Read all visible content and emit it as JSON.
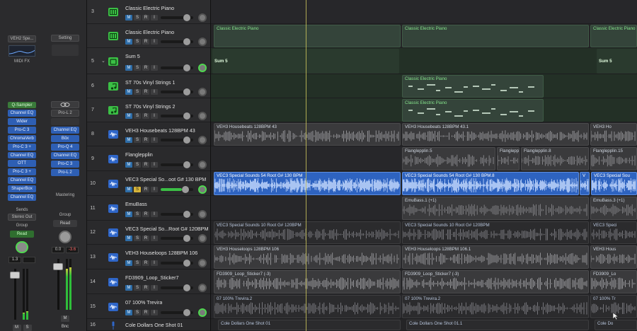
{
  "mixer": {
    "strip_a": {
      "instrument": "VEH2 Spe...",
      "midi_fx": "MIDI FX",
      "instrument_plugin": "Q-Sampler",
      "plugins": [
        "Channel EQ",
        "Wider",
        "Pro-C 3",
        "ChromaVerb",
        "Pro-C 3 +",
        "Channel EQ",
        "OTT",
        "Pro-C 3 +",
        "Channel EQ",
        "ShaperBox",
        "Channel EQ"
      ],
      "sends_label": "Sends",
      "output": "Stereo Out",
      "group_label": "Group",
      "automation": "Read",
      "volume": "1.3",
      "mute": "M",
      "solo": "S"
    },
    "strip_b": {
      "setting": "Setting",
      "link_icon": "link-icon",
      "plugins_top": [
        "Pro-L 2"
      ],
      "plugins": [
        "Channel EQ",
        "Böx",
        "Pro-Q 4",
        "Channel EQ",
        "Pro-C 3",
        "Pro-L 2"
      ],
      "mastering_label": "Mastering",
      "group_label": "Group",
      "automation": "Read",
      "volume": "0.0",
      "peak": "-3.6",
      "mute": "M",
      "bounce": "Bnc"
    }
  },
  "track_buttons": {
    "mute": "M",
    "solo": "S",
    "record": "R",
    "input": "I"
  },
  "tracks": [
    {
      "num": "3",
      "name": "Classic Electric Piano",
      "icon": "keyboard-icon",
      "kind": "midi"
    },
    {
      "num": "",
      "name": "Classic Electric Piano",
      "icon": "keyboard-icon",
      "kind": "midi"
    },
    {
      "num": "5",
      "name": "Sum 5",
      "icon": "stack-icon",
      "kind": "sum"
    },
    {
      "num": "6",
      "name": "ST 70s Vinyl Strings 1",
      "icon": "music-note-icon",
      "kind": "midi"
    },
    {
      "num": "7",
      "name": "ST 70s Vinyl Strings 2",
      "icon": "music-note-icon",
      "kind": "midi"
    },
    {
      "num": "8",
      "name": "VEH3 Housebeats 128BPM 43",
      "icon": "waveform-icon",
      "kind": "audio"
    },
    {
      "num": "9",
      "name": "Flanglepplin",
      "icon": "waveform-icon",
      "kind": "audio"
    },
    {
      "num": "10",
      "name": "VEC3 Special So...oot G# 130 BPM",
      "icon": "waveform-icon",
      "kind": "audio"
    },
    {
      "num": "11",
      "name": "EmuBass",
      "icon": "waveform-icon",
      "kind": "audio"
    },
    {
      "num": "12",
      "name": "VEC3 Special So...Root G# 120BPM",
      "icon": "waveform-icon",
      "kind": "audio"
    },
    {
      "num": "13",
      "name": "VEH3 Houseloops 128BPM 106",
      "icon": "waveform-icon",
      "kind": "audio"
    },
    {
      "num": "14",
      "name": "FD3909_Loop_Sticker7",
      "icon": "waveform-icon",
      "kind": "audio"
    },
    {
      "num": "15",
      "name": "07 100% Trevira",
      "icon": "waveform-icon",
      "kind": "audio"
    },
    {
      "num": "16",
      "name": "Cole Dollars One Shot 01",
      "icon": "microphone-icon",
      "kind": "audio"
    }
  ],
  "regions": {
    "r1": "Classic Electric Piano",
    "r2": "Classic Electric Piano",
    "r3": "Classic Electric Piano",
    "sum1": "Sum 5",
    "sum2": "Sum 5",
    "st1": "Classic Electric Piano",
    "st2": "Classic Electric Piano",
    "hb1": "VEH3 Housebeats 128BPM 43",
    "hb2": "VEH3 Housebeats 128BPM 43.1",
    "hb3": "VEH3 Ho",
    "fl1": "Flanglepplin.5",
    "fl2": "Flanglepp",
    "fl3": "Flanglepplin.8",
    "fl4": "Flanglepplin.15",
    "vec1": "VEC3 Special Sounds 54 Root G# 130 BPM",
    "vec2": "VEC3 Special Sounds 54 Root G# 130 BPM.8",
    "vec3": "V",
    "vec4": "VEC3 Special Sou",
    "emu1": "EmuBass.1 (+1)",
    "emu2": "EmuBass.3 (+1)",
    "vr1": "VEC3 Special Sounds 10 Root G# 120BPM",
    "vr2": "VEC3 Special Sounds 10 Root G# 120BPM",
    "vr3": "VEC3 Speci",
    "hl1": "VEH3 Houseloops 128BPM 106",
    "hl2": "VEH3 Houseloops 128BPM 106.1",
    "hl3": "VEH3 Hous",
    "fd1": "FD3909_Loop_Sticker7 (-3)",
    "fd2": "FD3909_Loop_Sticker7 (-3)",
    "fd3": "FD3909_Lo",
    "tv1": "07 100% Trevira.2",
    "tv2": "07 100% Trevira.2",
    "tv3": "07 100% Tr",
    "cd1": "Cole Dollars One Shot 01",
    "cd2": "Cole Dollars One Shot 01.1",
    "cd3": "Cole Do"
  }
}
